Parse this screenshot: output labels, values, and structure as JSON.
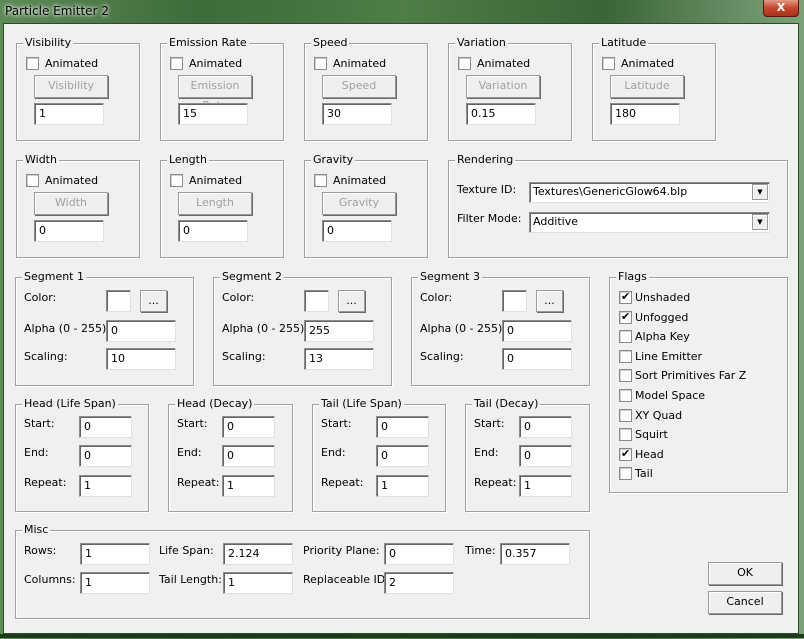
{
  "window": {
    "title": "Particle Emitter 2",
    "close_glyph": "X"
  },
  "animated_groups": [
    {
      "legend": "Visibility",
      "animated_label": "Animated",
      "animated": false,
      "button_label": "Visibility",
      "value": "1"
    },
    {
      "legend": "Emission Rate",
      "animated_label": "Animated",
      "animated": false,
      "button_label": "Emission Rate",
      "value": "15"
    },
    {
      "legend": "Speed",
      "animated_label": "Animated",
      "animated": false,
      "button_label": "Speed",
      "value": "30"
    },
    {
      "legend": "Variation",
      "animated_label": "Animated",
      "animated": false,
      "button_label": "Variation",
      "value": "0.15"
    },
    {
      "legend": "Latitude",
      "animated_label": "Animated",
      "animated": false,
      "button_label": "Latitude",
      "value": "180"
    },
    {
      "legend": "Width",
      "animated_label": "Animated",
      "animated": false,
      "button_label": "Width",
      "value": "0"
    },
    {
      "legend": "Length",
      "animated_label": "Animated",
      "animated": false,
      "button_label": "Length",
      "value": "0"
    },
    {
      "legend": "Gravity",
      "animated_label": "Animated",
      "animated": false,
      "button_label": "Gravity",
      "value": "0"
    }
  ],
  "rendering": {
    "legend": "Rendering",
    "texture_label": "Texture ID:",
    "texture_value": "Textures\\GenericGlow64.blp",
    "filter_label": "Filter Mode:",
    "filter_value": "Additive",
    "dropdown_glyph": "▼"
  },
  "segments": [
    {
      "legend": "Segment 1",
      "color_label": "Color:",
      "picker_label": "...",
      "alpha_label": "Alpha (0 - 255):",
      "alpha": "0",
      "scaling_label": "Scaling:",
      "scaling": "10",
      "color": "#ffffff"
    },
    {
      "legend": "Segment 2",
      "color_label": "Color:",
      "picker_label": "...",
      "alpha_label": "Alpha (0 - 255):",
      "alpha": "255",
      "scaling_label": "Scaling:",
      "scaling": "13",
      "color": "#ffffff"
    },
    {
      "legend": "Segment 3",
      "color_label": "Color:",
      "picker_label": "...",
      "alpha_label": "Alpha (0 - 255):",
      "alpha": "0",
      "scaling_label": "Scaling:",
      "scaling": "0",
      "color": "#ffffff"
    }
  ],
  "flags": {
    "legend": "Flags",
    "items": [
      {
        "label": "Unshaded",
        "checked": true
      },
      {
        "label": "Unfogged",
        "checked": true
      },
      {
        "label": "Alpha Key",
        "checked": false
      },
      {
        "label": "Line Emitter",
        "checked": false
      },
      {
        "label": "Sort Primitives Far Z",
        "checked": false
      },
      {
        "label": "Model Space",
        "checked": false
      },
      {
        "label": "XY Quad",
        "checked": false
      },
      {
        "label": "Squirt",
        "checked": false
      },
      {
        "label": "Head",
        "checked": true
      },
      {
        "label": "Tail",
        "checked": false
      }
    ]
  },
  "uv_groups": [
    {
      "legend": "Head (Life Span)",
      "start_label": "Start:",
      "start": "0",
      "end_label": "End:",
      "end": "0",
      "repeat_label": "Repeat:",
      "repeat": "1"
    },
    {
      "legend": "Head (Decay)",
      "start_label": "Start:",
      "start": "0",
      "end_label": "End:",
      "end": "0",
      "repeat_label": "Repeat:",
      "repeat": "1"
    },
    {
      "legend": "Tail (Life Span)",
      "start_label": "Start:",
      "start": "0",
      "end_label": "End:",
      "end": "0",
      "repeat_label": "Repeat:",
      "repeat": "1"
    },
    {
      "legend": "Tail (Decay)",
      "start_label": "Start:",
      "start": "0",
      "end_label": "End:",
      "end": "0",
      "repeat_label": "Repeat:",
      "repeat": "1"
    }
  ],
  "misc": {
    "legend": "Misc",
    "rows_label": "Rows:",
    "rows": "1",
    "columns_label": "Columns:",
    "columns": "1",
    "life_span_label": "Life Span:",
    "life_span": "2.124",
    "tail_length_label": "Tail Length:",
    "tail_length": "1",
    "priority_plane_label": "Priority Plane:",
    "priority_plane": "0",
    "replaceable_id_label": "Replaceable ID:",
    "replaceable_id": "2",
    "time_label": "Time:",
    "time": "0.357"
  },
  "actions": {
    "ok_label": "OK",
    "cancel_label": "Cancel"
  }
}
